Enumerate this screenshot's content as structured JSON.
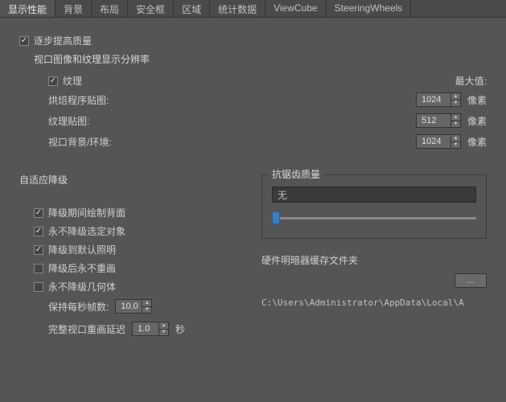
{
  "tabs": [
    {
      "label": "显示性能",
      "active": true
    },
    {
      "label": "背景"
    },
    {
      "label": "布局"
    },
    {
      "label": "安全框"
    },
    {
      "label": "区域"
    },
    {
      "label": "统计数据"
    },
    {
      "label": "ViewCube"
    },
    {
      "label": "SteeringWheels"
    }
  ],
  "quality": {
    "improve_progressive": "逐步提高质量",
    "resolution_title": "视口图像和纹理显示分辨率",
    "texture": "纹理",
    "max_value": "最大值:",
    "bake_map": "烘焙程序贴图:",
    "bake_val": "1024",
    "texture_map": "纹理贴图:",
    "texture_val": "512",
    "bg_env": "视口背景/环境:",
    "bg_val": "1024",
    "pixel_unit": "像素"
  },
  "degrade": {
    "title": "自适应降级",
    "draw_backface": "降级期间绘制背面",
    "never_selected": "永不降级选定对象",
    "to_default_light": "降级到默认照明",
    "never_redraw_after": "降级后永不重画",
    "never_geometry": "永不降级几何体",
    "keep_fps": "保持每秒帧数:",
    "keep_fps_val": "10.0",
    "full_redraw_delay": "完整视口重画延迟",
    "full_redraw_val": "1.0",
    "seconds": "秒"
  },
  "antialias": {
    "title": "抗锯齿质量",
    "value": "无"
  },
  "cache": {
    "title": "硬件明暗器缓存文件夹",
    "browse": "...",
    "path": "C:\\Users\\Administrator\\AppData\\Local\\A"
  }
}
